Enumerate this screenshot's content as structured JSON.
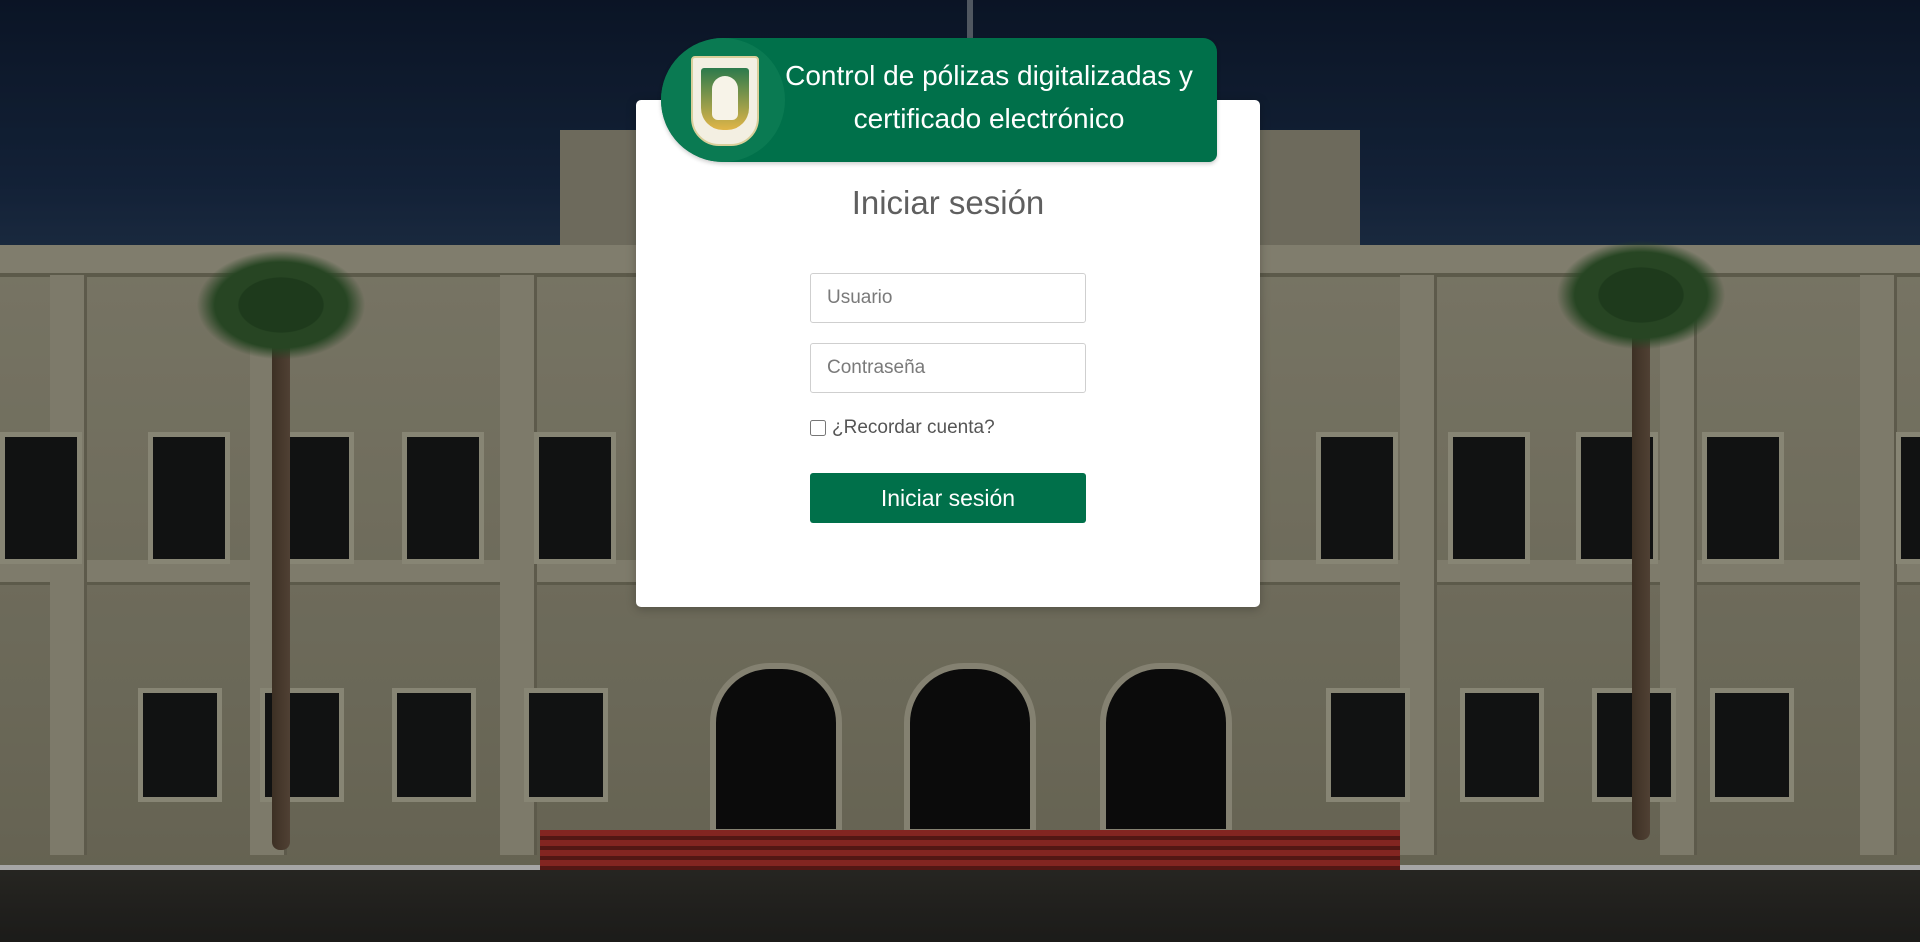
{
  "header": {
    "title": "Control de pólizas digitalizadas y certificado electrónico",
    "logo_icon": "university-seal"
  },
  "login": {
    "heading": "Iniciar sesión",
    "username_placeholder": "Usuario",
    "password_placeholder": "Contraseña",
    "remember_label": "¿Recordar cuenta?",
    "remember_checked": false,
    "submit_label": "Iniciar sesión"
  },
  "colors": {
    "brand_green": "#00704a",
    "card_background": "#ffffff",
    "heading_text": "#5f5f5f"
  }
}
